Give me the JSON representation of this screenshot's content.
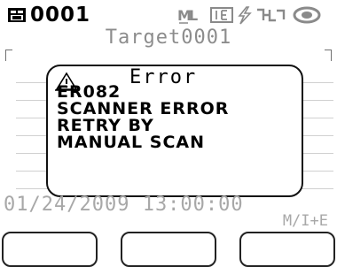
{
  "status_bar": {
    "target_number": "0001",
    "icons": [
      "target-data-icon",
      "measurement-mode-icon",
      "illuminant-icon",
      "flash-icon",
      "connection-icon",
      "battery-icon"
    ]
  },
  "screen": {
    "title": "Target0001"
  },
  "dialog": {
    "title": "Error",
    "icon": "warning-icon",
    "lines": [
      "ER082",
      "SCANNER ERROR",
      "RETRY BY",
      "MANUAL SCAN"
    ]
  },
  "footer": {
    "datetime": "01/24/2009 13:00:00",
    "mode": "M/I+E"
  },
  "softkeys": [
    "",
    "",
    ""
  ],
  "colors": {
    "background": "#ffffff",
    "text": "#000000",
    "muted": "#a8a8a8"
  }
}
